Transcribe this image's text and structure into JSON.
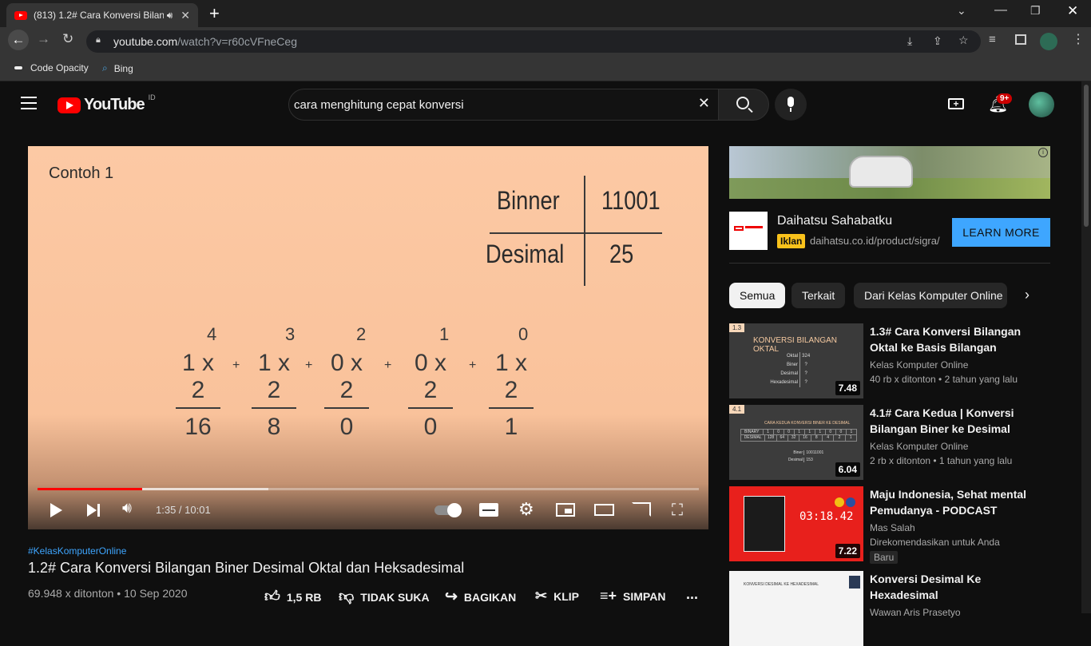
{
  "browser": {
    "tab_title": "(813) 1.2# Cara Konversi Bilan",
    "url_host": "youtube.com",
    "url_path": "/watch?v=r60cVFneCeg",
    "bookmarks": [
      {
        "label": "Code Opacity",
        "icon": "code-opacity-icon"
      },
      {
        "label": "Bing",
        "icon": "search-icon"
      }
    ]
  },
  "youtube": {
    "logo_text": "YouTube",
    "country_code": "ID",
    "search_value": "cara menghitung cepat konversi",
    "notification_count": "9+"
  },
  "video": {
    "slide": {
      "heading": "Contoh 1",
      "table_left_top": "Binner",
      "table_right_top": "11001",
      "table_left_bottom": "Desimal",
      "table_right_bottom": "25",
      "terms": [
        {
          "exp": "4",
          "expr": "1 x 2",
          "result": "16"
        },
        {
          "exp": "3",
          "expr": "1 x 2",
          "result": "8"
        },
        {
          "exp": "2",
          "expr": "0 x 2",
          "result": "0"
        },
        {
          "exp": "1",
          "expr": "0 x 2",
          "result": "0"
        },
        {
          "exp": "0",
          "expr": "1 x 2",
          "result": "1"
        }
      ],
      "plus": "+"
    },
    "player": {
      "time": "1:35 / 10:01",
      "played_fraction": 0.158,
      "buffered_fraction": 0.349
    },
    "hashtag": "#KelasKomputerOnline",
    "title": "1.2# Cara Konversi Bilangan Biner Desimal Oktal dan Heksadesimal",
    "stats": "69.948 x ditonton • 10 Sep 2020",
    "actions": {
      "like": "1,5 RB",
      "dislike": "TIDAK SUKA",
      "share": "BAGIKAN",
      "clip": "KLIP",
      "save": "SIMPAN",
      "more": "..."
    }
  },
  "ad": {
    "title": "Daihatsu Sahabatku",
    "badge": "Iklan",
    "url": "daihatsu.co.id/product/sigra/",
    "cta": "LEARN MORE"
  },
  "chips": [
    "Semua",
    "Terkait",
    "Dari Kelas Komputer Online"
  ],
  "recommendations": [
    {
      "title": "1.3# Cara Konversi Bilangan Oktal ke Basis Bilangan Yang...",
      "channel": "Kelas Komputer Online",
      "meta": "40 rb x ditonton • 2 tahun yang lalu",
      "duration": "7.48",
      "thumb_badge": "1.3",
      "thumb_heading": "KONVERSI BILANGAN OKTAL",
      "thumb_rows": [
        [
          "Oktal",
          "324"
        ],
        [
          "Biner",
          "?"
        ],
        [
          "Desimal",
          "?"
        ],
        [
          "Hexadesimal",
          "?"
        ]
      ]
    },
    {
      "title": "4.1# Cara Kedua | Konversi Bilangan Biner ke Desimal",
      "channel": "Kelas Komputer Online",
      "meta": "2 rb x ditonton • 1 tahun yang lalu",
      "duration": "6.04",
      "thumb_badge": "4.1",
      "thumb_heading": "CARA KEDUA KONVERSI BINER KE DESIMAL",
      "thumb_row1": [
        "BINARY",
        "1",
        "0",
        "0",
        "1",
        "1",
        "1",
        "0",
        "0",
        "1"
      ],
      "thumb_row2": [
        "DESIMAL",
        "128",
        "64",
        "32",
        "16",
        "8",
        "4",
        "2",
        "1"
      ],
      "thumb_result": [
        "Biner",
        "10011001",
        "Desimal",
        "153"
      ]
    },
    {
      "title": "Maju Indonesia, Sehat mental Pemudanya - PODCAST 24TH...",
      "channel": "Mas Salah",
      "meta": "Direkomendasikan untuk Anda",
      "new_badge": "Baru",
      "duration": "7.22",
      "thumb_clock": "03:18.42"
    },
    {
      "title": "Konversi Desimal Ke Hexadesimal",
      "channel": "Wawan Aris Prasetyo",
      "thumb_heading": "KONVERSI DESIMAL KE HEXADESIMAL"
    }
  ],
  "colors": {
    "accent_red": "#ff0000",
    "link_blue": "#3ea6ff",
    "ad_badge": "#f9c21b",
    "slide_bg": "#fcc9a4"
  }
}
